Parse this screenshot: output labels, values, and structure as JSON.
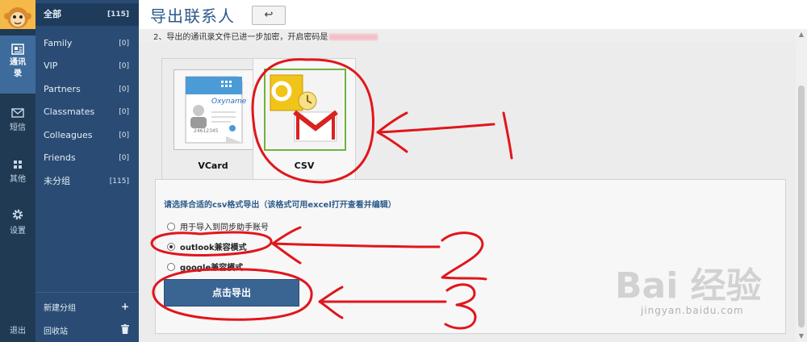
{
  "rail": {
    "items": [
      {
        "label": "通讯录",
        "icon": "contacts-icon"
      },
      {
        "label": "短信",
        "icon": "mail-icon"
      },
      {
        "label": "其他",
        "icon": "grid-icon"
      },
      {
        "label": "设置",
        "icon": "gear-icon"
      }
    ],
    "exit_label": "退出"
  },
  "groups": {
    "items": [
      {
        "name": "全部",
        "count": "[115]"
      },
      {
        "name": "Family",
        "count": "[0]"
      },
      {
        "name": "VIP",
        "count": "[0]"
      },
      {
        "name": "Partners",
        "count": "[0]"
      },
      {
        "name": "Classmates",
        "count": "[0]"
      },
      {
        "name": "Colleagues",
        "count": "[0]"
      },
      {
        "name": "Friends",
        "count": "[0]"
      },
      {
        "name": "未分组",
        "count": "[115]"
      }
    ],
    "new_group_label": "新建分组",
    "new_group_action": "+",
    "recycle_label": "回收站"
  },
  "main": {
    "title": "导出联系人",
    "back_symbol": "↩",
    "notice": "2、导出的通讯录文件已进一步加密，开启密码是",
    "formats": [
      {
        "name": "VCard",
        "card_brand": "Oxyname",
        "card_number": "24612345"
      },
      {
        "name": "CSV"
      }
    ],
    "options_hint": "请选择合适的csv格式导出（该格式可用excel打开查看并编辑）",
    "options": [
      {
        "label": "用于导入到同步助手账号",
        "checked": false
      },
      {
        "label": "outlook兼容模式",
        "checked": true
      },
      {
        "label": "google兼容模式",
        "checked": false
      }
    ],
    "export_label": "点击导出"
  },
  "watermark": {
    "text": "Bai 经验",
    "url": "jingyan.baidu.com"
  },
  "colors": {
    "rail": "#203a54",
    "sidebar": "#2a4c74",
    "accent": "#2c5a8c",
    "button": "#3a6593",
    "annotation": "#e0161c"
  }
}
